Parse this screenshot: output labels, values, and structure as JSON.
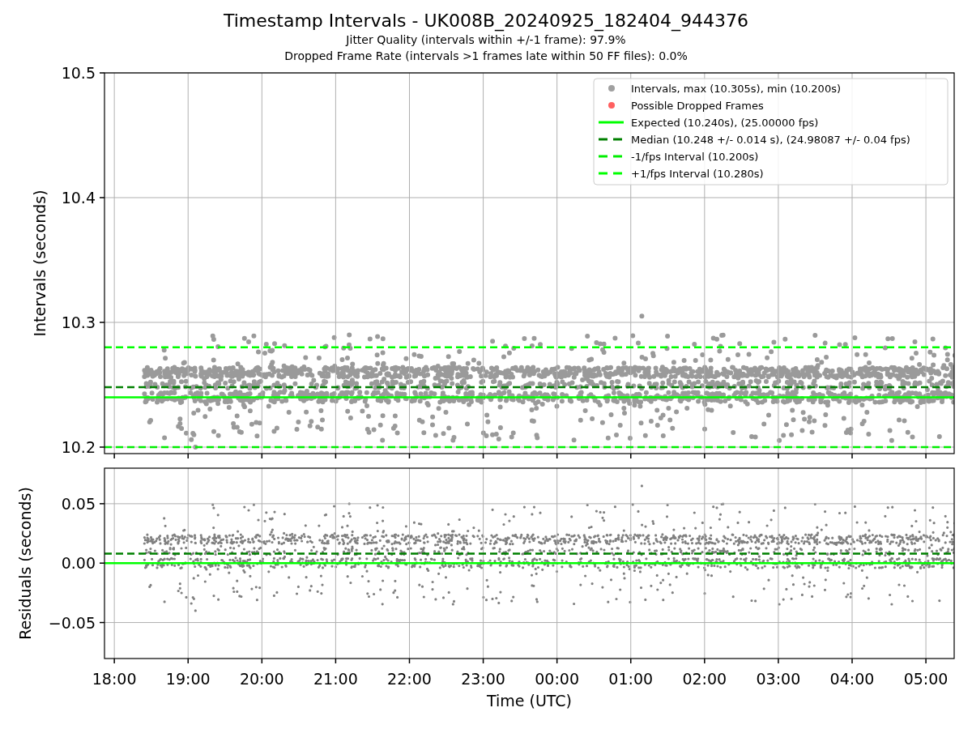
{
  "title": "Timestamp Intervals - UK008B_20240925_182404_944376",
  "subtitles": [
    "Jitter Quality (intervals within +/-1 frame): 97.9%",
    "Dropped Frame Rate (intervals >1 frames late within 50 FF files): 0.0%"
  ],
  "intervals_plot": {
    "markers": [
      {
        "kind": "dot",
        "color": "#a0a0a0",
        "label": "Intervals, max (10.305s), min (10.200s)"
      },
      {
        "kind": "dot",
        "color": "#ff6060",
        "label": "Possible Dropped Frames"
      }
    ],
    "chart_data": {
      "type": "line",
      "ylabel": "Intervals (seconds)",
      "grid": true,
      "legend": "upper right",
      "x": [
        "2024-09-25T17:52",
        "2024-09-26T05:23"
      ],
      "series": [
        {
          "name": "Expected (10.240s), (25.00000 fps)",
          "color": "#00ff00",
          "line_style": "solid",
          "values": [
            10.24,
            10.24
          ]
        },
        {
          "name": "Median (10.248 +/- 0.014 s), (24.98087 +/- 0.04 fps)",
          "color": "#008000",
          "line_style": "dashed",
          "values": [
            10.248,
            10.248
          ]
        },
        {
          "name": "-1/fps Interval (10.200s)",
          "color": "#00ee00",
          "line_style": "dashed",
          "values": [
            10.2,
            10.2
          ]
        },
        {
          "name": "+1/fps Interval (10.280s)",
          "color": "#00ff00",
          "line_style": "dashed",
          "values": [
            10.28,
            10.28
          ]
        }
      ],
      "xlim": [
        "2024-09-25T17:52",
        "2024-09-26T05:23"
      ],
      "ylim": [
        10.1948,
        10.5
      ],
      "yticks": [
        {
          "value": 10.2,
          "label": "10.2"
        },
        {
          "value": 10.3,
          "label": "10.3"
        },
        {
          "value": 10.4,
          "label": "10.4"
        },
        {
          "value": 10.5,
          "label": "10.5"
        }
      ]
    }
  },
  "residuals_plot": {
    "chart_data": {
      "type": "line",
      "xlabel": "Time (UTC)",
      "ylabel": "Residuals (seconds)",
      "grid": true,
      "x": [
        "2024-09-25T17:52",
        "2024-09-26T05:23"
      ],
      "series": [
        {
          "color": "#00ff00",
          "line_style": "solid",
          "values": [
            0,
            0
          ]
        },
        {
          "color": "#008000",
          "line_style": "dashed",
          "values": [
            0.008,
            0.008
          ]
        }
      ],
      "xlim": [
        "2024-09-25T17:52",
        "2024-09-26T05:23"
      ],
      "ylim": [
        -0.0803,
        0.0799
      ],
      "xticks": [
        {
          "value": "2024-09-25T18:00",
          "label": "18:00"
        },
        {
          "value": "2024-09-25T19:00",
          "label": "19:00"
        },
        {
          "value": "2024-09-25T20:00",
          "label": "20:00"
        },
        {
          "value": "2024-09-25T21:00",
          "label": "21:00"
        },
        {
          "value": "2024-09-25T22:00",
          "label": "22:00"
        },
        {
          "value": "2024-09-25T23:00",
          "label": "23:00"
        },
        {
          "value": "2024-09-26T00:00",
          "label": "00:00"
        },
        {
          "value": "2024-09-26T01:00",
          "label": "01:00"
        },
        {
          "value": "2024-09-26T02:00",
          "label": "02:00"
        },
        {
          "value": "2024-09-26T03:00",
          "label": "03:00"
        },
        {
          "value": "2024-09-26T04:00",
          "label": "04:00"
        },
        {
          "value": "2024-09-26T05:00",
          "label": "05:00"
        }
      ],
      "yticks": [
        {
          "value": 0.05,
          "label": "0.05"
        },
        {
          "value": 0,
          "label": "0.00"
        },
        {
          "value": -0.05,
          "label": "−0.05"
        }
      ]
    }
  }
}
